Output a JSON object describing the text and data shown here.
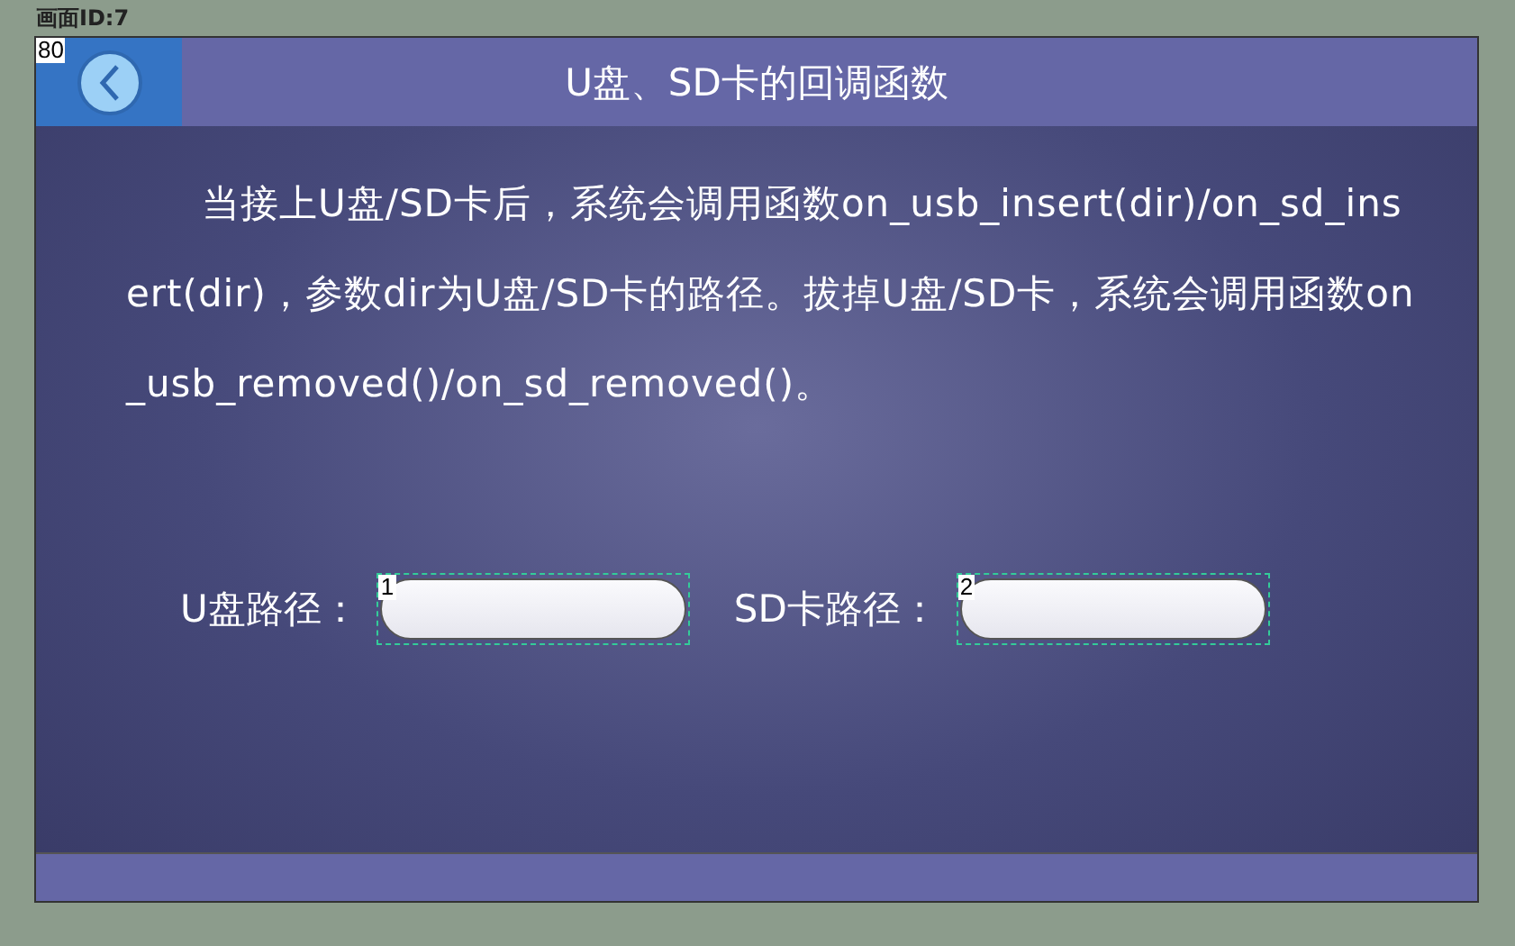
{
  "editor": {
    "screen_label": "画面ID:7"
  },
  "header": {
    "title": "U盘、SD卡的回调函数",
    "back_button": {
      "widget_id": "80"
    }
  },
  "description": "当接上U盘/SD卡后，系统会调用函数on_usb_insert(dir)/on_sd_insert(dir)，参数dir为U盘/SD卡的路径。拔掉U盘/SD卡，系统会调用函数on_usb_removed()/on_sd_removed()。",
  "fields": [
    {
      "label": "U盘路径：",
      "widget_id": "1"
    },
    {
      "label": "SD卡路径：",
      "widget_id": "2"
    }
  ]
}
